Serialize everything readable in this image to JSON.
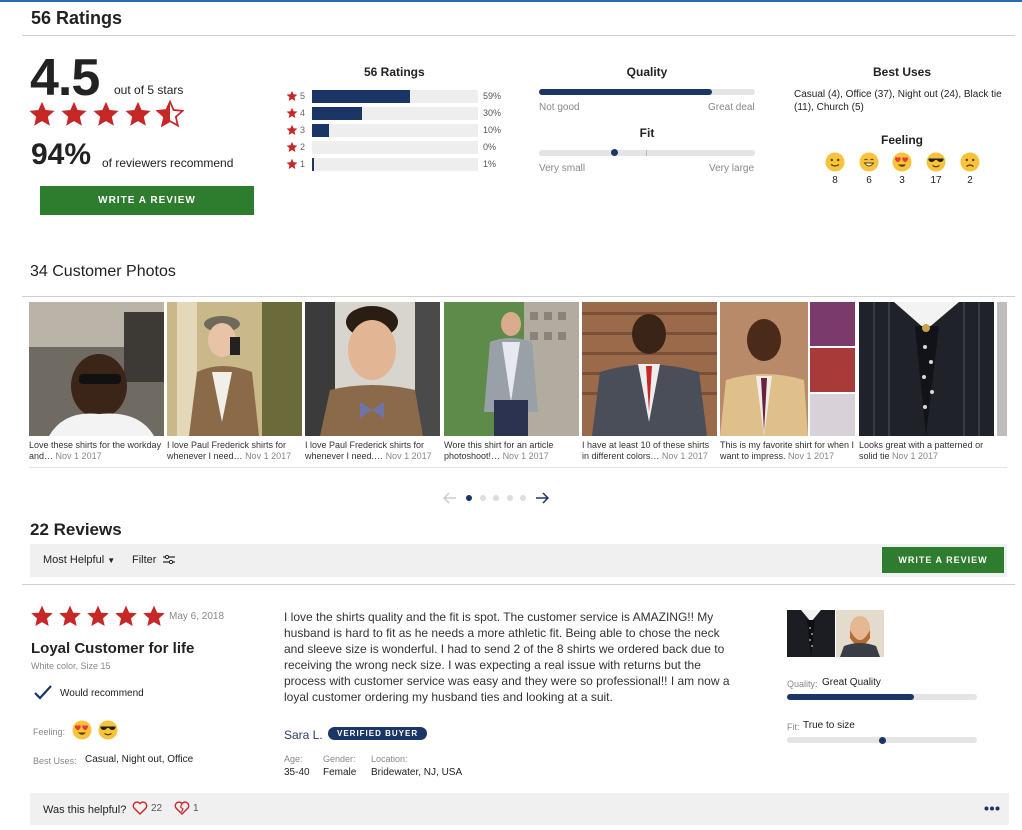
{
  "summary": {
    "heading": "56 Ratings",
    "average": "4.5",
    "out_of": "out of 5 stars",
    "recommend_pct": "94%",
    "recommend_label": "of reviewers recommend",
    "write_review": "WRITE A REVIEW"
  },
  "histogram": {
    "title": "56 Ratings",
    "rows": [
      {
        "star": "5",
        "pct": "59%",
        "fraction": 0.59
      },
      {
        "star": "4",
        "pct": "30%",
        "fraction": 0.3
      },
      {
        "star": "3",
        "pct": "10%",
        "fraction": 0.1
      },
      {
        "star": "2",
        "pct": "0%",
        "fraction": 0.0
      },
      {
        "star": "1",
        "pct": "1%",
        "fraction": 0.01
      }
    ]
  },
  "quality": {
    "title": "Quality",
    "low": "Not good",
    "high": "Great deal",
    "level": 0.8
  },
  "fit": {
    "title": "Fit",
    "low": "Very small",
    "high": "Very large",
    "level": 0.35
  },
  "best_uses": {
    "title": "Best Uses",
    "text": "Casual (4), Office (37), Night out (24), Black tie (11), Church (5)"
  },
  "feeling": {
    "title": "Feeling",
    "items": [
      {
        "icon": "smile-icon",
        "count": "8"
      },
      {
        "icon": "grin-icon",
        "count": "6"
      },
      {
        "icon": "heart-eyes-icon",
        "count": "3"
      },
      {
        "icon": "sunglasses-icon",
        "count": "17"
      },
      {
        "icon": "frown-icon",
        "count": "2"
      }
    ]
  },
  "photos": {
    "heading": "34 Customer Photos",
    "items": [
      {
        "caption": "Love these shirts for the workday and…",
        "date": "Nov 1 2017"
      },
      {
        "caption": "I love Paul Frederick shirts for whenever I need…",
        "date": "Nov 1 2017"
      },
      {
        "caption": "I love Paul Frederick shirts for whenever I need.…",
        "date": "Nov 1 2017"
      },
      {
        "caption": "Wore this shirt for an article photoshoot!…",
        "date": "Nov 1 2017"
      },
      {
        "caption": "I have at least 10 of these shirts in different colors…",
        "date": "Nov 1 2017"
      },
      {
        "caption": "This is my favorite shirt for when I want to impress.",
        "date": "Nov 1 2017"
      },
      {
        "caption": "Looks great with a patterned or solid tie",
        "date": "Nov 1 2017"
      }
    ]
  },
  "reviews": {
    "heading": "22 Reviews",
    "sort_label": "Most Helpful",
    "filter_label": "Filter",
    "write_review": "WRITE A REVIEW"
  },
  "review": {
    "date": "May 6, 2018",
    "title": "Loyal Customer for life",
    "meta": "White color, Size 15",
    "recommend": "Would recommend",
    "feeling_label": "Feeling:",
    "best_uses_label": "Best Uses:",
    "best_uses": "Casual, Night out, Office",
    "body": "I love the shirts quality and the fit is spot. The customer service is AMAZING!! My husband is hard to fit as he needs a more athletic fit. Being able to chose the neck and sleeve size is wonderful. I had to send 2 of the 8 shirts we ordered back due to receiving the wrong neck size. I was expecting a real issue with returns but the process with customer service was easy and they were so professional!! I am now a loyal customer ordering my husband ties and looking at a suit.",
    "reviewer": "Sara L.",
    "badge": "VERIFIED BUYER",
    "age_label": "Age:",
    "age": "35-40",
    "gender_label": "Gender:",
    "gender": "Female",
    "location_label": "Location:",
    "location": "Bridewater, NJ, USA",
    "quality_label": "Quality:",
    "quality_value": "Great Quality",
    "quality_level": 0.67,
    "fit_label": "Fit:",
    "fit_value": "True to size",
    "fit_level": 0.5,
    "helpful_q": "Was this helpful?",
    "helpful_yes": "22",
    "helpful_no": "1"
  },
  "colors": {
    "star": "#c62828",
    "navy": "#1b3566",
    "green": "#2e7d2e"
  }
}
